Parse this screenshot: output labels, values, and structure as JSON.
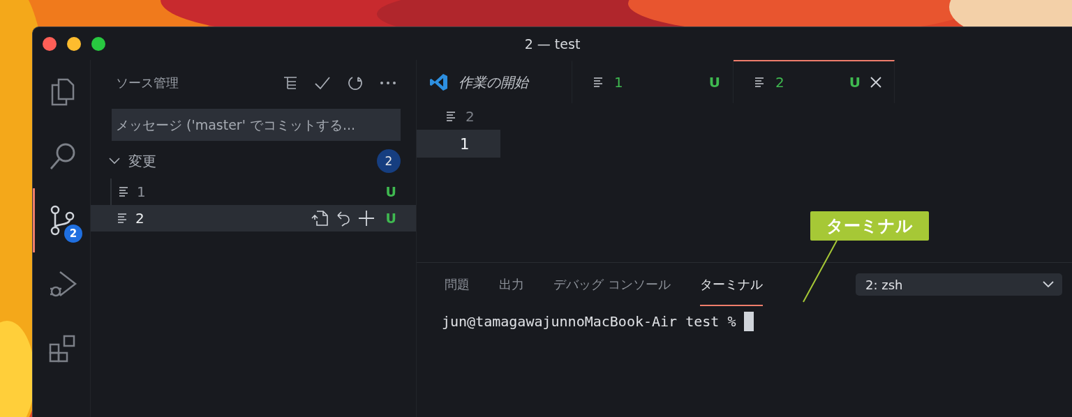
{
  "window": {
    "title": "2 — test"
  },
  "activity_bar": [
    {
      "kind": "files",
      "selected": false
    },
    {
      "kind": "search",
      "selected": false
    },
    {
      "kind": "scm",
      "selected": true,
      "badge": "2"
    },
    {
      "kind": "debug",
      "selected": false
    },
    {
      "kind": "extensions",
      "selected": false
    }
  ],
  "sidebar": {
    "title": "ソース管理",
    "commit_message": {
      "placeholder": "メッセージ ('master' でコミットする..."
    },
    "group": {
      "label": "変更",
      "count": "2",
      "expanded": true,
      "files": [
        {
          "name": "1",
          "status": "U",
          "selected": false
        },
        {
          "name": "2",
          "status": "U",
          "selected": true
        }
      ]
    }
  },
  "editor": {
    "tabs": [
      {
        "kind": "welcome",
        "label": "作業の開始",
        "selected": false
      },
      {
        "kind": "file",
        "label": "1",
        "status": "U",
        "selected": false
      },
      {
        "kind": "file",
        "label": "2",
        "status": "U",
        "selected": true
      }
    ],
    "breadcrumb": "2",
    "line_numbers": [
      "1"
    ]
  },
  "panel": {
    "tabs": [
      {
        "label": "問題",
        "selected": false
      },
      {
        "label": "出力",
        "selected": false
      },
      {
        "label": "デバッグ コンソール",
        "selected": false
      },
      {
        "label": "ターミナル",
        "selected": true
      }
    ],
    "terminal_select": "2: zsh",
    "prompt": "jun@tamagawajunnoMacBook-Air test %"
  },
  "annotation": {
    "label": "ターミナル"
  }
}
